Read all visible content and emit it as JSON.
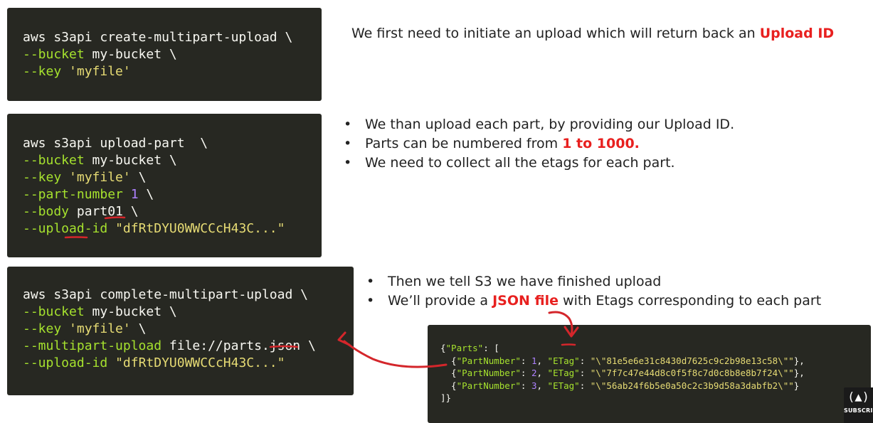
{
  "colors": {
    "code_bg": "#272822",
    "highlight": "#e8201f",
    "annotation": "#d4262b"
  },
  "box1": {
    "l1_plain": "aws s3api create-multipart-upload \\",
    "l2_flag": "--bucket",
    "l2_rest": " my-bucket \\",
    "l3_flag": "--key",
    "l3_str": "'myfile'"
  },
  "note1": {
    "text": "We first need to initiate an upload which will return back an ",
    "highlight": "Upload ID"
  },
  "box2": {
    "l1_plain": "aws s3api upload-part  \\",
    "l2_flag": "--bucket",
    "l2_rest": " my-bucket \\",
    "l3_flag": "--key",
    "l3_str": "'myfile'",
    "l3_rest": " \\",
    "l4_flag": "--part-number",
    "l4_num": "1",
    "l4_rest": " \\",
    "l5_flag": "--body",
    "l5_rest": " part01 \\",
    "l6_flag": "--upload-id",
    "l6_str": "\"dfRtDYU0WWCCcH43C...\""
  },
  "list2": {
    "b1": "We than upload each part, by providing our Upload ID.",
    "b2_text": "Parts can be numbered from ",
    "b2_highlight": "1 to 1000.",
    "b3": "We need to collect all the etags for each part."
  },
  "box3": {
    "l1_plain": "aws s3api complete-multipart-upload \\",
    "l2_flag": "--bucket",
    "l2_rest": " my-bucket \\",
    "l3_flag": "--key",
    "l3_str": "'myfile'",
    "l3_rest": " \\",
    "l4_flag": "--multipart-upload",
    "l4_rest": " file://parts.json \\",
    "l5_flag": "--upload-id",
    "l5_str": "\"dfRtDYU0WWCCcH43C...\""
  },
  "list3": {
    "b1": "Then we tell S3 we have finished upload",
    "b2_pre": "We’ll provide a ",
    "b2_highlight": "JSON file",
    "b2_post": " with Etags corresponding to each part"
  },
  "json": {
    "open_key": "\"Parts\"",
    "open_rest": ": [",
    "key_pn": "\"PartNumber\"",
    "key_et": "\"ETag\"",
    "rows": [
      {
        "pn": "1",
        "etag": "\"\\\"81e5e6e31c8430d7625c9c2b98e13c58\\\"\""
      },
      {
        "pn": "2",
        "etag": "\"\\\"7f7c47e44d8c0f5f8c7d0c8b8e8b7f24\\\"\""
      },
      {
        "pn": "3",
        "etag": "\"\\\"56ab24f6b5e0a50c2c3b9d58a3dabfb2\\\"\""
      }
    ],
    "close": "]}"
  },
  "badge": {
    "icon": "code-bracket-logo-icon",
    "glyph": "(▲)",
    "label": "SUBSCRIBE"
  }
}
